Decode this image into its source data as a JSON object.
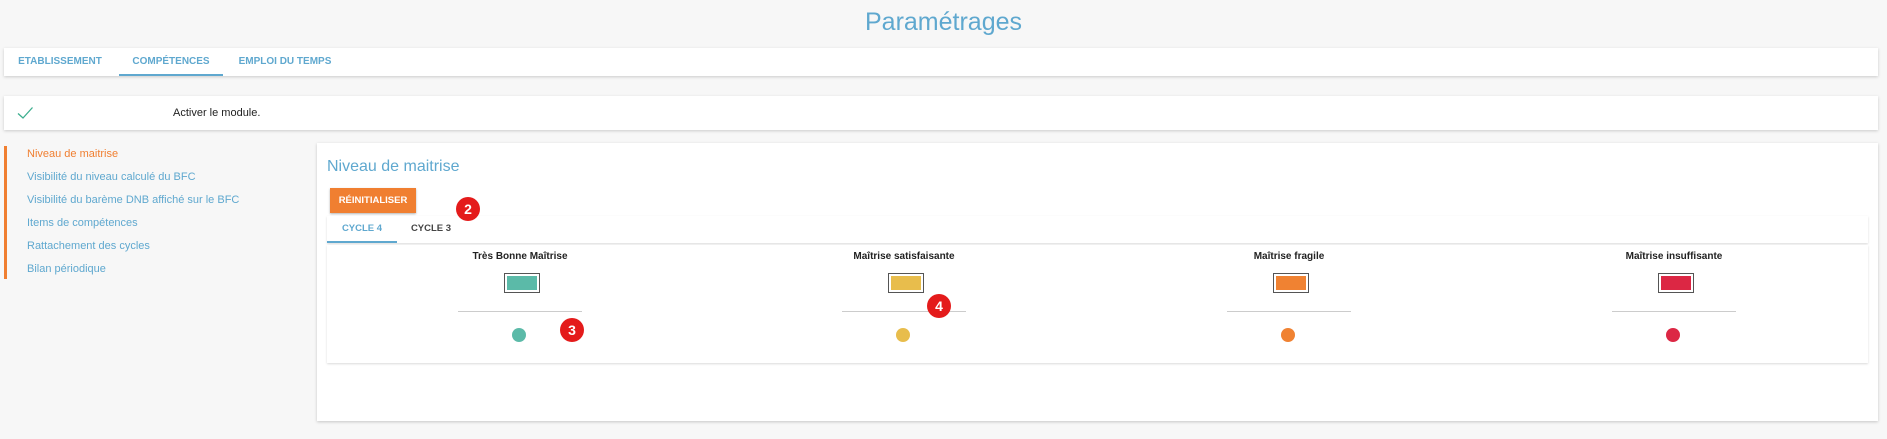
{
  "page_title": "Paramétrages",
  "top_tabs": [
    {
      "label": "ETABLISSEMENT"
    },
    {
      "label": "COMPÉTENCES"
    },
    {
      "label": "EMPLOI DU TEMPS"
    }
  ],
  "module": {
    "label": "Activer le module.",
    "icon": "check-icon"
  },
  "sidebar": {
    "items": [
      {
        "label": "Niveau de maitrise"
      },
      {
        "label": "Visibilité du niveau calculé du BFC"
      },
      {
        "label": "Visibilité du barème DNB affiché sur le BFC"
      },
      {
        "label": "Items de compétences"
      },
      {
        "label": "Rattachement des cycles"
      },
      {
        "label": "Bilan périodique"
      }
    ]
  },
  "main": {
    "title": "Niveau de maitrise",
    "reset_label": "RÉINITIALISER",
    "cycle_tabs": [
      {
        "label": "CYCLE 4"
      },
      {
        "label": "CYCLE 3"
      }
    ],
    "levels": [
      {
        "name": "Très Bonne Maîtrise",
        "color": "#5bbaa8"
      },
      {
        "name": "Maîtrise satisfaisante",
        "color": "#e8bd4c"
      },
      {
        "name": "Maîtrise fragile",
        "color": "#f08232"
      },
      {
        "name": "Maîtrise insuffisante",
        "color": "#dc2744"
      }
    ]
  },
  "badges": [
    "2",
    "3",
    "4"
  ],
  "colors": {
    "accent": "#5fa8cf",
    "active": "#f07f31",
    "badge": "#e41b1b"
  }
}
